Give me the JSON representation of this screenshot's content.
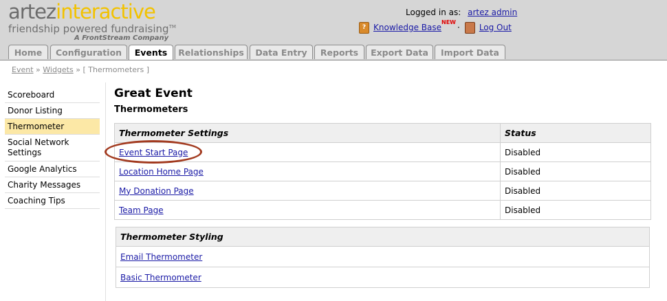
{
  "logo": {
    "word1": "artez",
    "word2": "interactive",
    "tagline": "friendship powered fundraising",
    "tagline_tm": "TM",
    "company": "A FrontStream Company"
  },
  "header": {
    "logged_in_label": "Logged in as:",
    "user": "artez admin",
    "knowledge_base": "Knowledge Base",
    "new_badge": "NEW",
    "separator": "·",
    "logout": "Log Out"
  },
  "tabs": [
    "Home",
    "Configuration",
    "Events",
    "Relationships",
    "Data Entry",
    "Reports",
    "Export Data",
    "Import Data"
  ],
  "breadcrumb": {
    "event": "Event",
    "sep1": "»",
    "widgets": "Widgets",
    "sep2": "»",
    "current": "[ Thermometers ]"
  },
  "sidebar": {
    "items": [
      {
        "label": "Scoreboard"
      },
      {
        "label": "Donor Listing"
      },
      {
        "label": "Thermometer"
      },
      {
        "label": "Social Network Settings"
      },
      {
        "label": "Google Analytics"
      },
      {
        "label": "Charity Messages"
      },
      {
        "label": "Coaching Tips"
      }
    ],
    "active": "Thermometer"
  },
  "main": {
    "event_title": "Great Event",
    "section_title": "Thermometers",
    "settings_table": {
      "headers": [
        "Thermometer Settings",
        "Status"
      ],
      "rows": [
        {
          "page": "Event Start Page",
          "status": "Disabled"
        },
        {
          "page": "Location Home Page",
          "status": "Disabled"
        },
        {
          "page": "My Donation Page",
          "status": "Disabled"
        },
        {
          "page": "Team Page",
          "status": "Disabled"
        }
      ]
    },
    "styling_table": {
      "header": "Thermometer Styling",
      "rows": [
        "Email Thermometer",
        "Basic Thermometer"
      ]
    }
  },
  "colors": {
    "header_bg": "#d6d6d6",
    "logo_accent": "#f2c200",
    "active_sidebar": "#fce8a6",
    "link": "#1a1aa6",
    "highlight_ring": "#a23a1f"
  }
}
